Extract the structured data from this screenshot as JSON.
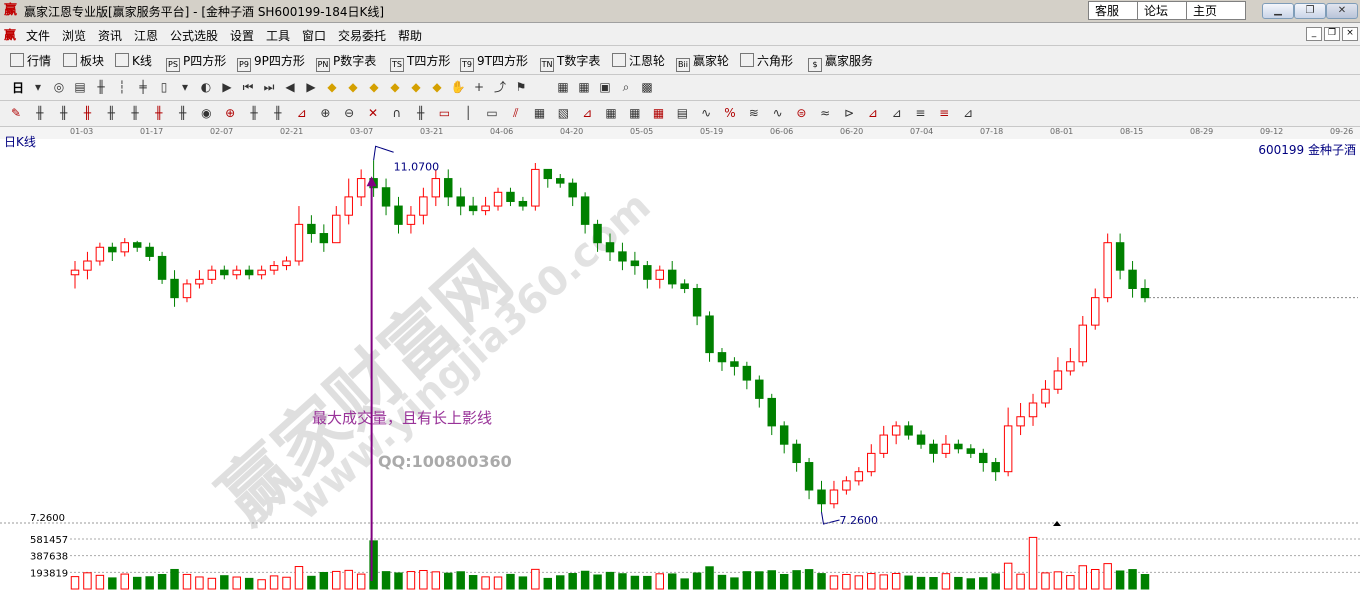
{
  "window": {
    "app_icon": "赢",
    "title": "赢家江恩专业版[赢家服务平台] - [金种子酒  SH600199-184日K线]",
    "links": [
      "客服",
      "论坛",
      "主页"
    ],
    "controls": [
      "minimize-icon",
      "restore-icon",
      "close-icon"
    ]
  },
  "menu": {
    "logo": "赢",
    "items": [
      "文件",
      "浏览",
      "资讯",
      "江恩",
      "公式选股",
      "设置",
      "工具",
      "窗口",
      "交易委托",
      "帮助"
    ]
  },
  "toolbar1": {
    "items": [
      {
        "label": "行情",
        "icon": "grid-icon",
        "iconText": ""
      },
      {
        "label": "板块",
        "icon": "blocks-icon",
        "iconText": ""
      },
      {
        "label": "K线",
        "icon": "kline-icon",
        "iconText": ""
      },
      {
        "label": "P四方形",
        "icon": "ps-icon",
        "iconText": "PS"
      },
      {
        "label": "9P四方形",
        "icon": "p9-icon",
        "iconText": "P9"
      },
      {
        "label": "P数字表",
        "icon": "pn-icon",
        "iconText": "PN"
      },
      {
        "label": "T四方形",
        "icon": "ts-icon",
        "iconText": "TS"
      },
      {
        "label": "9T四方形",
        "icon": "t9-icon",
        "iconText": "T9"
      },
      {
        "label": "T数字表",
        "icon": "tn-icon",
        "iconText": "TN"
      },
      {
        "label": "江恩轮",
        "icon": "wheel-icon",
        "iconText": ""
      },
      {
        "label": "赢家轮",
        "icon": "bii-icon",
        "iconText": "Bii"
      },
      {
        "label": "六角形",
        "icon": "hexagon-icon",
        "iconText": ""
      },
      {
        "label": "赢家服务",
        "icon": "dollar-icon",
        "iconText": "$"
      }
    ]
  },
  "toolbar2": {
    "period_label": "日",
    "icons": [
      "dropdown-icon",
      "cycle-icon",
      "doc-icon",
      "candles-icon",
      "bars-icon",
      "lines-icon",
      "cursor-icon",
      "dropdown-icon",
      "scale-icon",
      "flag-icon",
      "first-icon",
      "last-icon",
      "left-icon",
      "right-icon",
      "diamond-up-icon",
      "diamond-down-icon",
      "diamond-left-icon",
      "diamond-right-icon",
      "diamond-shrink-icon",
      "diamond-expand-icon",
      "hand-icon",
      "crosshair-icon",
      "draw-icon",
      "vane-icon",
      "blank-icon",
      "calendar-icon",
      "calc-icon",
      "save-icon",
      "find-icon",
      "cube-icon"
    ]
  },
  "toolbar3": {
    "icons": [
      "pen-icon",
      "line1-icon",
      "line2-icon",
      "line3-icon",
      "line4-icon",
      "line5-icon",
      "line6-icon",
      "line7-icon",
      "circle-icon",
      "fan-icon",
      "grid-line-icon",
      "gann-icon",
      "angle-icon",
      "target-icon",
      "target2-icon",
      "cross-icon",
      "arc-icon",
      "parallel-icon",
      "stack-icon",
      "sep-icon",
      "rect-icon",
      "fan2-icon",
      "box-icon",
      "box2-icon",
      "angle2-icon",
      "table-icon",
      "table2-icon",
      "table3-icon",
      "list-icon",
      "curve-icon",
      "percent-icon",
      "fib-icon",
      "wave-icon",
      "gold-icon",
      "vol-icon",
      "exp-icon",
      "tri-icon",
      "tri2-icon",
      "tri3-icon",
      "tri4-icon",
      "tri5-icon"
    ]
  },
  "chart": {
    "caption_left": "日K线",
    "caption_right": "600199  金种子酒",
    "date_ticks": [
      "01-03",
      "01-17",
      "02-07",
      "02-21",
      "03-07",
      "03-21",
      "04-06",
      "04-20",
      "05-05",
      "05-19",
      "06-06",
      "06-20",
      "07-04",
      "07-18",
      "08-01",
      "08-15",
      "08-29",
      "09-12",
      "09-26"
    ],
    "annotations": {
      "high_label": "11.0700",
      "low_label": "7.2600",
      "note": "最大成交量，且有长上影线",
      "qq": "QQ:100800360",
      "watermark1": "赢家财富网",
      "watermark2": "www.yingjia360.com"
    },
    "volume_labels": [
      "7.2600",
      "581457",
      "387638",
      "193819"
    ],
    "colors": {
      "up": "#ff0000",
      "down": "#008000",
      "annotation": "#993399",
      "arrow": "#800080"
    }
  },
  "chart_data": {
    "type": "candlestick",
    "symbol": "600199",
    "name": "金种子酒",
    "period": "日K线",
    "x_ticks": [
      "01-03",
      "01-17",
      "02-07",
      "02-21",
      "03-07",
      "03-21",
      "04-06",
      "04-20",
      "05-05",
      "05-19",
      "06-06",
      "06-20",
      "07-04",
      "07-18",
      "08-01",
      "08-15",
      "08-29",
      "09-12",
      "09-26"
    ],
    "price_high": 11.07,
    "price_low": 7.26,
    "volume_ticks": [
      581457,
      387638,
      193819
    ],
    "candles": [
      [
        9.85,
        9.9,
        9.7,
        10.0
      ],
      [
        9.9,
        10.0,
        9.8,
        10.1
      ],
      [
        10.0,
        10.15,
        9.95,
        10.2
      ],
      [
        10.15,
        10.1,
        10.0,
        10.2
      ],
      [
        10.1,
        10.2,
        10.05,
        10.25
      ],
      [
        10.2,
        10.15,
        10.1,
        10.22
      ],
      [
        10.15,
        10.05,
        10.0,
        10.2
      ],
      [
        10.05,
        9.8,
        9.75,
        10.1
      ],
      [
        9.8,
        9.6,
        9.5,
        9.9
      ],
      [
        9.6,
        9.75,
        9.55,
        9.8
      ],
      [
        9.75,
        9.8,
        9.7,
        9.9
      ],
      [
        9.8,
        9.9,
        9.75,
        9.95
      ],
      [
        9.9,
        9.85,
        9.8,
        9.95
      ],
      [
        9.85,
        9.9,
        9.8,
        9.95
      ],
      [
        9.9,
        9.85,
        9.8,
        9.95
      ],
      [
        9.85,
        9.9,
        9.8,
        9.95
      ],
      [
        9.9,
        9.95,
        9.85,
        10.0
      ],
      [
        9.95,
        10.0,
        9.9,
        10.05
      ],
      [
        10.0,
        10.4,
        9.95,
        10.6
      ],
      [
        10.4,
        10.3,
        10.2,
        10.5
      ],
      [
        10.3,
        10.2,
        10.1,
        10.4
      ],
      [
        10.2,
        10.5,
        10.2,
        10.6
      ],
      [
        10.5,
        10.7,
        10.4,
        10.9
      ],
      [
        10.7,
        10.9,
        10.6,
        11.0
      ],
      [
        10.9,
        10.8,
        10.7,
        11.1
      ],
      [
        10.8,
        10.6,
        10.5,
        10.9
      ],
      [
        10.6,
        10.4,
        10.3,
        10.7
      ],
      [
        10.4,
        10.5,
        10.3,
        10.6
      ],
      [
        10.5,
        10.7,
        10.4,
        10.8
      ],
      [
        10.7,
        10.9,
        10.6,
        11.0
      ],
      [
        10.9,
        10.7,
        10.6,
        11.0
      ],
      [
        10.7,
        10.6,
        10.5,
        10.8
      ],
      [
        10.6,
        10.55,
        10.5,
        10.7
      ],
      [
        10.55,
        10.6,
        10.5,
        10.7
      ],
      [
        10.6,
        10.75,
        10.55,
        10.8
      ],
      [
        10.75,
        10.65,
        10.6,
        10.8
      ],
      [
        10.65,
        10.6,
        10.55,
        10.7
      ],
      [
        10.6,
        11.0,
        10.55,
        11.07
      ],
      [
        11.0,
        10.9,
        10.8,
        11.0
      ],
      [
        10.9,
        10.85,
        10.8,
        10.95
      ],
      [
        10.85,
        10.7,
        10.6,
        10.9
      ],
      [
        10.7,
        10.4,
        10.3,
        10.75
      ],
      [
        10.4,
        10.2,
        10.1,
        10.45
      ],
      [
        10.2,
        10.1,
        10.0,
        10.3
      ],
      [
        10.1,
        10.0,
        9.9,
        10.2
      ],
      [
        10.0,
        9.95,
        9.85,
        10.1
      ],
      [
        9.95,
        9.8,
        9.7,
        10.0
      ],
      [
        9.8,
        9.9,
        9.7,
        9.95
      ],
      [
        9.9,
        9.75,
        9.7,
        10.0
      ],
      [
        9.75,
        9.7,
        9.65,
        9.8
      ],
      [
        9.7,
        9.4,
        9.3,
        9.75
      ],
      [
        9.4,
        9.0,
        8.9,
        9.45
      ],
      [
        9.0,
        8.9,
        8.8,
        9.05
      ],
      [
        8.9,
        8.85,
        8.75,
        8.95
      ],
      [
        8.85,
        8.7,
        8.6,
        8.9
      ],
      [
        8.7,
        8.5,
        8.4,
        8.75
      ],
      [
        8.5,
        8.2,
        8.1,
        8.55
      ],
      [
        8.2,
        8.0,
        7.9,
        8.25
      ],
      [
        8.0,
        7.8,
        7.7,
        8.05
      ],
      [
        7.8,
        7.5,
        7.4,
        7.85
      ],
      [
        7.5,
        7.35,
        7.26,
        7.6
      ],
      [
        7.35,
        7.5,
        7.3,
        7.6
      ],
      [
        7.5,
        7.6,
        7.45,
        7.65
      ],
      [
        7.6,
        7.7,
        7.55,
        7.75
      ],
      [
        7.7,
        7.9,
        7.65,
        8.0
      ],
      [
        7.9,
        8.1,
        7.85,
        8.2
      ],
      [
        8.1,
        8.2,
        8.0,
        8.25
      ],
      [
        8.2,
        8.1,
        8.05,
        8.25
      ],
      [
        8.1,
        8.0,
        7.95,
        8.15
      ],
      [
        8.0,
        7.9,
        7.8,
        8.05
      ],
      [
        7.9,
        8.0,
        7.85,
        8.1
      ],
      [
        8.0,
        7.95,
        7.9,
        8.05
      ],
      [
        7.95,
        7.9,
        7.85,
        8.0
      ],
      [
        7.9,
        7.8,
        7.7,
        7.95
      ],
      [
        7.8,
        7.7,
        7.6,
        7.85
      ],
      [
        7.7,
        8.2,
        7.65,
        8.4
      ],
      [
        8.2,
        8.3,
        8.1,
        8.45
      ],
      [
        8.3,
        8.45,
        8.2,
        8.55
      ],
      [
        8.45,
        8.6,
        8.4,
        8.7
      ],
      [
        8.6,
        8.8,
        8.55,
        8.95
      ],
      [
        8.8,
        8.9,
        8.75,
        9.05
      ],
      [
        8.9,
        9.3,
        8.85,
        9.4
      ],
      [
        9.3,
        9.6,
        9.25,
        9.7
      ],
      [
        9.6,
        10.2,
        9.55,
        10.3
      ],
      [
        10.2,
        9.9,
        9.8,
        10.3
      ],
      [
        9.9,
        9.7,
        9.6,
        10.0
      ],
      [
        9.7,
        9.6,
        9.55,
        9.8
      ]
    ]
  }
}
